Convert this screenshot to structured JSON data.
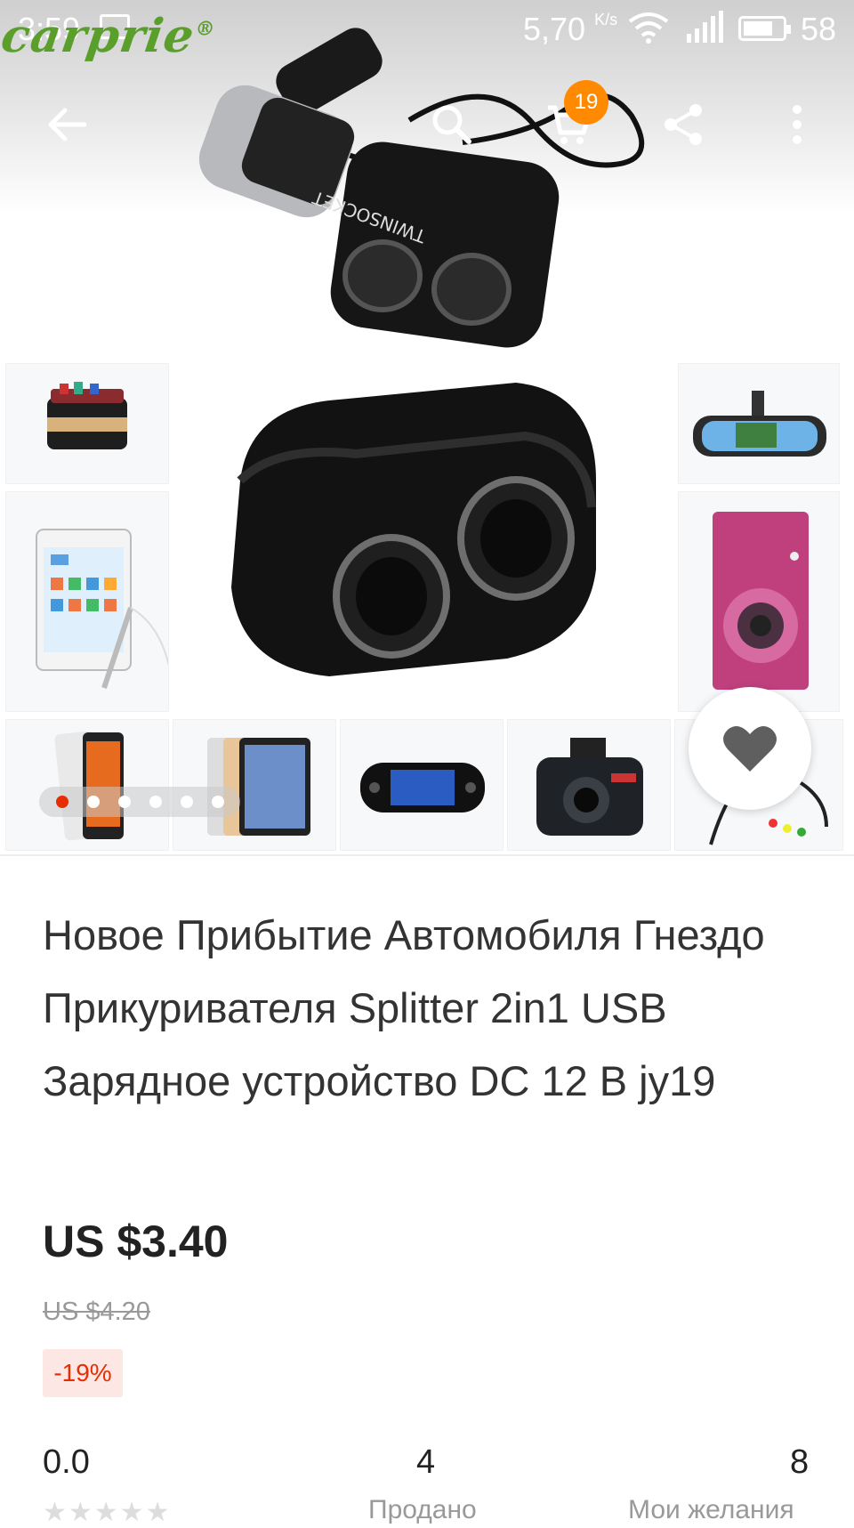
{
  "status_bar": {
    "time": "3:59",
    "net_speed": "5,70",
    "net_unit": "K/s",
    "battery": "58"
  },
  "watermark": "carprie",
  "top_bar": {
    "cart_count": "19",
    "icons": [
      "back-arrow-icon",
      "search-icon",
      "cart-icon",
      "share-icon",
      "more-vert-icon"
    ]
  },
  "gallery": {
    "total_images": 6,
    "active_index": 0
  },
  "product": {
    "title": "Новое Прибытие Автомобиля Гнездо Прикуривателя Splitter 2in1 USB Зарядное устройство DC 12 В jy19",
    "price": "US $3.40",
    "original_price": "US $4.20",
    "discount": "-19%"
  },
  "stats": {
    "rating": "0.0",
    "sold_count": "4",
    "sold_label": "Продано",
    "wishlist_count": "8",
    "wishlist_label": "Мои желания"
  },
  "colors": {
    "accent": "#e62e04",
    "badge": "#ff8a00",
    "brand_green": "#5a9e2c"
  }
}
